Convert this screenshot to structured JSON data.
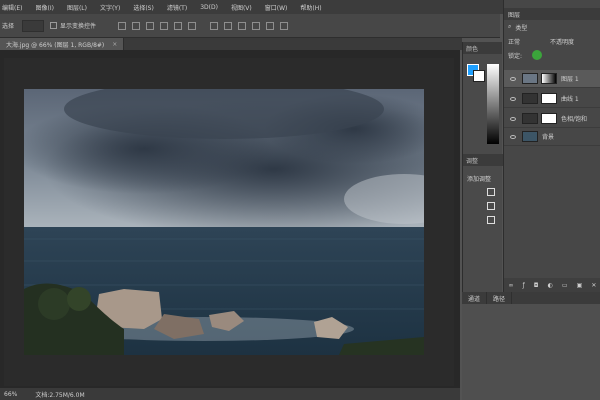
{
  "menu": {
    "items": [
      "编辑(E)",
      "图像(I)",
      "图层(L)",
      "文字(Y)",
      "选择(S)",
      "滤镜(T)",
      "3D(D)",
      "视图(V)",
      "窗口(W)",
      "帮助(H)"
    ]
  },
  "options": {
    "tool_label": "选择",
    "select_value": "",
    "show_transform_label": "显示变换控件"
  },
  "document": {
    "tab_title": "大海.jpg @ 66% (图层 1, RGB/8#)",
    "close_glyph": "×"
  },
  "status": {
    "zoom": "66%",
    "doc_info": "文档:2.75M/6.0M"
  },
  "mid_panel": {
    "color_tab": "颜色",
    "adjust_tab": "调整",
    "add_adjust": "添加调整"
  },
  "layers_panel": {
    "tab": "图层",
    "kind_filter": "类型",
    "blend_mode": "正常",
    "opacity_label": "不透明度",
    "lock_label": "锁定:",
    "layers": [
      {
        "name": "图层 1",
        "visible": true
      },
      {
        "name": "曲线 1",
        "visible": true
      },
      {
        "name": "色相/饱和",
        "visible": true
      },
      {
        "name": "背景",
        "visible": true
      }
    ]
  },
  "bottom_panel": {
    "tabs": [
      "通道",
      "路径"
    ]
  },
  "colors": {
    "accent": "#1ea0ff",
    "panel": "#474747",
    "workarea": "#282828"
  }
}
